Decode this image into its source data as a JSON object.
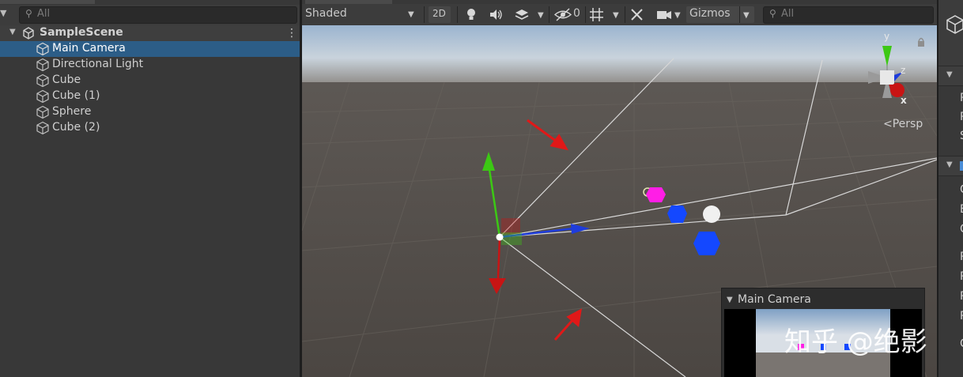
{
  "hierarchy": {
    "search_placeholder": "All",
    "scene_name": "SampleScene",
    "items": [
      {
        "label": "Main Camera",
        "selected": true
      },
      {
        "label": "Directional Light",
        "selected": false
      },
      {
        "label": "Cube",
        "selected": false
      },
      {
        "label": "Cube (1)",
        "selected": false
      },
      {
        "label": "Sphere",
        "selected": false
      },
      {
        "label": "Cube (2)",
        "selected": false
      }
    ]
  },
  "scene_toolbar": {
    "draw_mode": "Shaded",
    "mode_2d": "2D",
    "hidden_count": "0",
    "gizmos": "Gizmos",
    "search_placeholder": "All"
  },
  "viewport": {
    "projection_label": "<Persp",
    "axis_x": "x",
    "axis_y": "y",
    "axis_z": "z"
  },
  "camera_preview": {
    "title": "Main Camera"
  },
  "watermark": "知乎 @绝影",
  "inspector": {
    "clipped_chars": [
      "P",
      "P",
      "S",
      "C",
      "E",
      "C",
      "P",
      "P",
      "P",
      "P",
      "C"
    ]
  },
  "colors": {
    "selection": "#2c5d87",
    "axis_x": "#c81414",
    "axis_y": "#3cc814",
    "axis_z": "#1e3cdc",
    "object_blue": "#1448ff",
    "object_magenta": "#ff1ee6"
  }
}
